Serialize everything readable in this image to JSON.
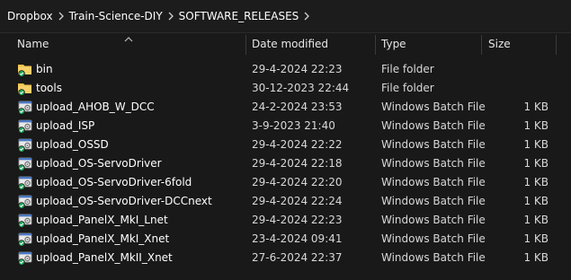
{
  "breadcrumb": {
    "items": [
      "Dropbox",
      "Train-Science-DIY",
      "SOFTWARE_RELEASES"
    ]
  },
  "columns": {
    "name": "Name",
    "date_modified": "Date modified",
    "type": "Type",
    "size": "Size"
  },
  "icons": {
    "folder": "folder-icon",
    "batch": "batch-file-icon",
    "sync": "dropbox-synced-check-icon",
    "separator": "chevron-right-icon",
    "sort": "sort-ascending-caret-icon"
  },
  "colors": {
    "background": "#191919",
    "folder": "#f2c14e",
    "sync_check": "#1fa75b"
  },
  "files": [
    {
      "name": "bin",
      "date": "29-4-2024 22:23",
      "type": "File folder",
      "size": "",
      "kind": "folder"
    },
    {
      "name": "tools",
      "date": "30-12-2023 22:44",
      "type": "File folder",
      "size": "",
      "kind": "folder"
    },
    {
      "name": "upload_AHOB_W_DCC",
      "date": "24-2-2024 23:53",
      "type": "Windows Batch File",
      "size": "1 KB",
      "kind": "batch"
    },
    {
      "name": "upload_ISP",
      "date": "3-9-2023 21:40",
      "type": "Windows Batch File",
      "size": "1 KB",
      "kind": "batch"
    },
    {
      "name": "upload_OSSD",
      "date": "29-4-2024 22:22",
      "type": "Windows Batch File",
      "size": "1 KB",
      "kind": "batch"
    },
    {
      "name": "upload_OS-ServoDriver",
      "date": "29-4-2024 22:18",
      "type": "Windows Batch File",
      "size": "1 KB",
      "kind": "batch"
    },
    {
      "name": "upload_OS-ServoDriver-6fold",
      "date": "29-4-2024 22:20",
      "type": "Windows Batch File",
      "size": "1 KB",
      "kind": "batch"
    },
    {
      "name": "upload_OS-ServoDriver-DCCnext",
      "date": "29-4-2024 22:24",
      "type": "Windows Batch File",
      "size": "1 KB",
      "kind": "batch"
    },
    {
      "name": "upload_PanelX_MkI_Lnet",
      "date": "29-4-2024 22:23",
      "type": "Windows Batch File",
      "size": "1 KB",
      "kind": "batch"
    },
    {
      "name": "upload_PanelX_MkI_Xnet",
      "date": "23-4-2024 09:41",
      "type": "Windows Batch File",
      "size": "1 KB",
      "kind": "batch"
    },
    {
      "name": "upload_PanelX_MkII_Xnet",
      "date": "27-6-2024 22:37",
      "type": "Windows Batch File",
      "size": "1 KB",
      "kind": "batch"
    }
  ]
}
